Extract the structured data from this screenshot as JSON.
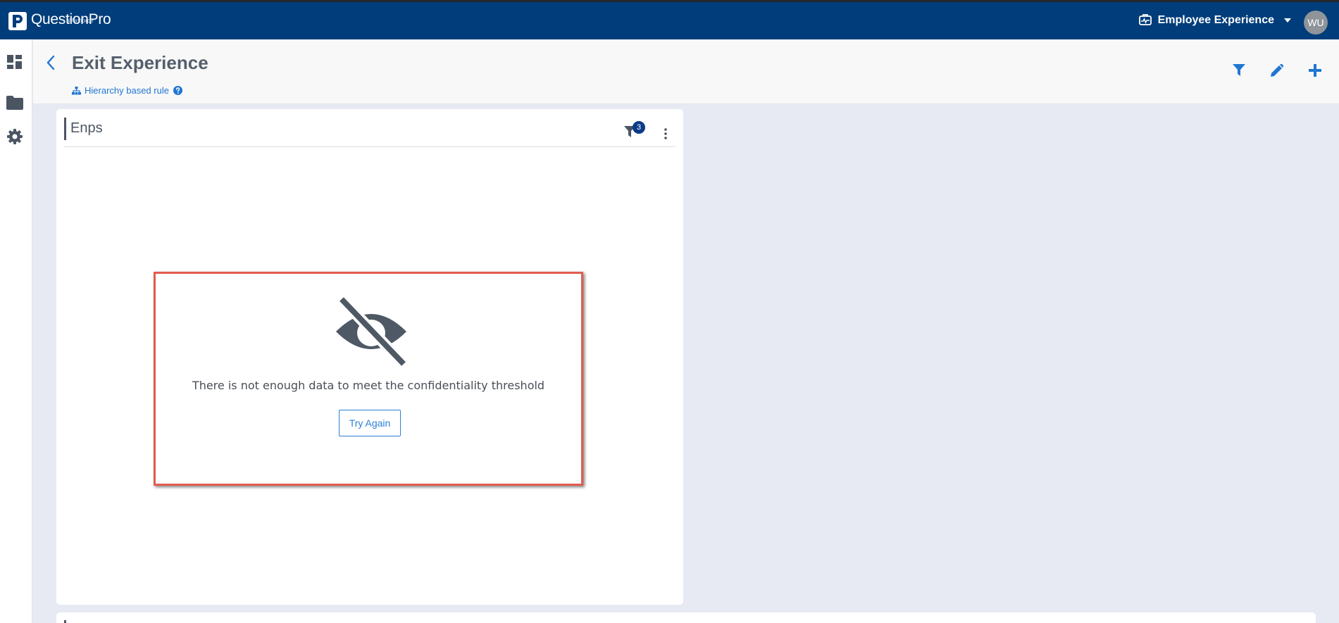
{
  "app": {
    "brand": "QuestionPro",
    "brand_sub": "Workforce",
    "product": "Employee Experience",
    "user_initials": "WU"
  },
  "header": {
    "title": "Exit Experience",
    "rule_label": "Hierarchy based rule"
  },
  "widget": {
    "title": "Enps",
    "filter_count": "3",
    "empty_message": "There is not enough data to meet the confidentiality threshold",
    "retry_label": "Try Again"
  },
  "colors": {
    "topbar": "#003d7a",
    "accent": "#2176d2",
    "highlight_border": "#e25c4f",
    "badge": "#0d3b8a"
  },
  "icons": {
    "sidebar": [
      "dashboard-icon",
      "folder-icon",
      "gear-icon"
    ],
    "header_actions": [
      "filter-icon",
      "pencil-icon",
      "plus-icon"
    ]
  }
}
